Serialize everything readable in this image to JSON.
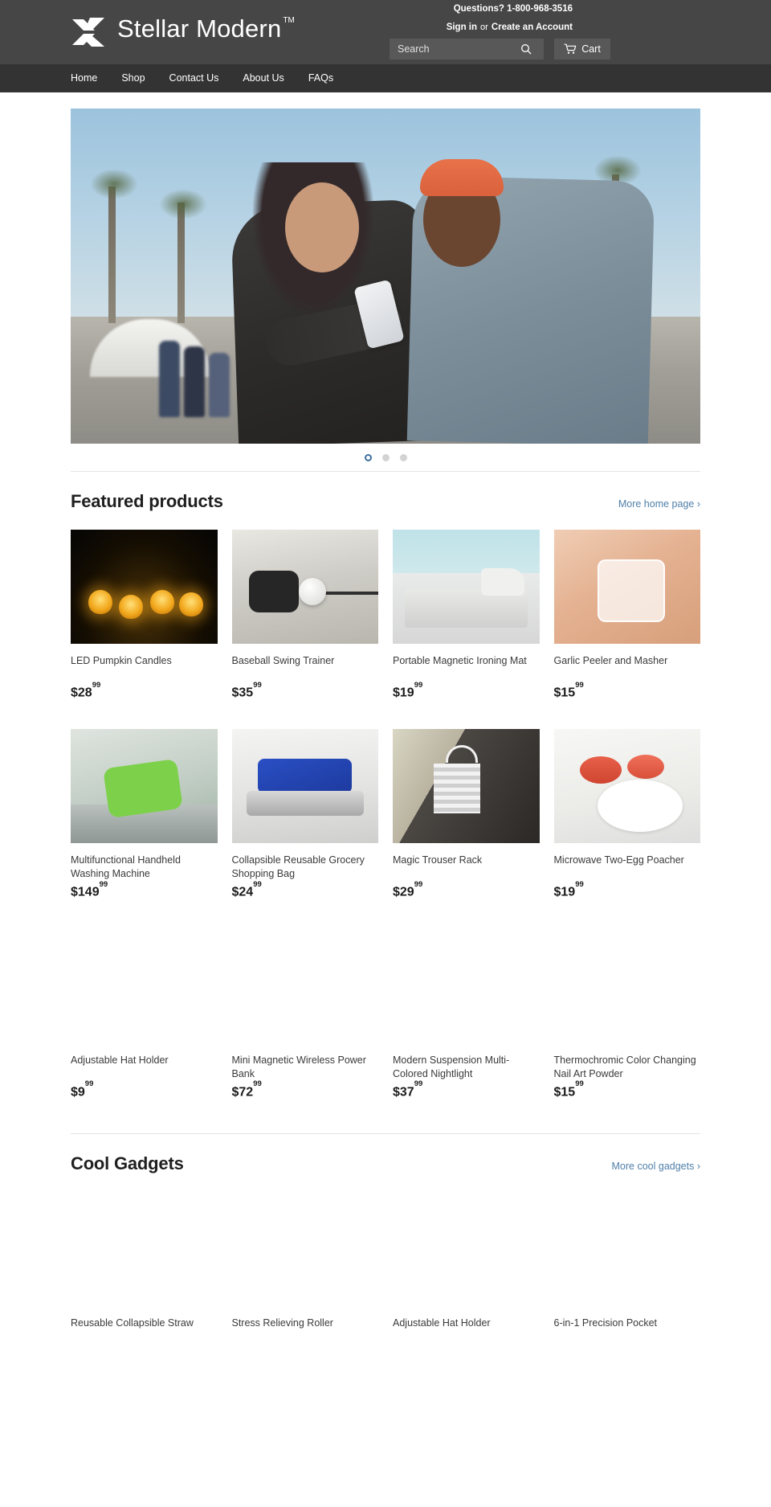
{
  "header": {
    "logo_text": "Stellar Modern",
    "logo_tm": "TM",
    "logo_mark_icon": "x-arrow-logo-icon",
    "questions": "Questions? 1-800-968-3516",
    "sign_in": "Sign in",
    "or": "or",
    "create_account": "Create an Account",
    "search_placeholder": "Search",
    "search_value": "",
    "search_icon": "search-icon",
    "cart_label": "Cart",
    "cart_icon": "shopping-cart-icon",
    "bg_color": "#464646"
  },
  "nav": {
    "items": [
      {
        "label": "Home"
      },
      {
        "label": "Shop"
      },
      {
        "label": "Contact Us"
      },
      {
        "label": "About Us"
      },
      {
        "label": "FAQs"
      }
    ],
    "bg_color": "#333333"
  },
  "hero": {
    "alt": "Two people taking a selfie outdoors on a boardwalk",
    "dots": [
      {
        "active": true
      },
      {
        "active": false
      },
      {
        "active": false
      }
    ],
    "active_dot_color": "#3c6e9f",
    "inactive_dot_color": "#d3d3d3"
  },
  "sections": [
    {
      "title": "Featured products",
      "link_label": "More home page ›",
      "link_color": "#4f7fa8",
      "products": [
        {
          "title": "LED Pumpkin Candles",
          "price_dollars": "$28",
          "price_cents": "99",
          "art": "a-pumpkin",
          "has_image": true
        },
        {
          "title": "Baseball Swing Trainer",
          "price_dollars": "$35",
          "price_cents": "99",
          "art": "a-baseball",
          "has_image": true
        },
        {
          "title": "Portable Magnetic Ironing Mat",
          "price_dollars": "$19",
          "price_cents": "99",
          "art": "a-iron",
          "has_image": true
        },
        {
          "title": "Garlic Peeler and Masher",
          "price_dollars": "$15",
          "price_cents": "99",
          "art": "a-garlic",
          "has_image": true
        },
        {
          "title": "Multifunctional Handheld Washing Machine",
          "price_dollars": "$149",
          "price_cents": "99",
          "art": "a-wash",
          "has_image": true
        },
        {
          "title": "Collapsible Reusable Grocery Shopping Bag",
          "price_dollars": "$24",
          "price_cents": "99",
          "art": "a-bag",
          "has_image": true
        },
        {
          "title": "Magic Trouser Rack",
          "price_dollars": "$29",
          "price_cents": "99",
          "art": "a-trouser",
          "has_image": true
        },
        {
          "title": "Microwave Two-Egg Poacher",
          "price_dollars": "$19",
          "price_cents": "99",
          "art": "a-egg",
          "has_image": true
        },
        {
          "title": "Adjustable Hat Holder",
          "price_dollars": "$9",
          "price_cents": "99",
          "art": "",
          "has_image": false
        },
        {
          "title": "Mini Magnetic Wireless Power Bank",
          "price_dollars": "$72",
          "price_cents": "99",
          "art": "",
          "has_image": false
        },
        {
          "title": "Modern Suspension Multi-Colored Nightlight",
          "price_dollars": "$37",
          "price_cents": "99",
          "art": "",
          "has_image": false
        },
        {
          "title": "Thermochromic Color Changing Nail Art Powder",
          "price_dollars": "$15",
          "price_cents": "99",
          "art": "",
          "has_image": false
        }
      ]
    },
    {
      "title": "Cool Gadgets",
      "link_label": "More cool gadgets ›",
      "link_color": "#4f7fa8",
      "products": [
        {
          "title": "Reusable Collapsible Straw",
          "price_dollars": "",
          "price_cents": "",
          "art": "",
          "has_image": false
        },
        {
          "title": "Stress Relieving Roller",
          "price_dollars": "",
          "price_cents": "",
          "art": "",
          "has_image": false
        },
        {
          "title": "Adjustable Hat Holder",
          "price_dollars": "",
          "price_cents": "",
          "art": "",
          "has_image": false
        },
        {
          "title": "6-in-1 Precision Pocket",
          "price_dollars": "",
          "price_cents": "",
          "art": "",
          "has_image": false
        }
      ]
    }
  ]
}
